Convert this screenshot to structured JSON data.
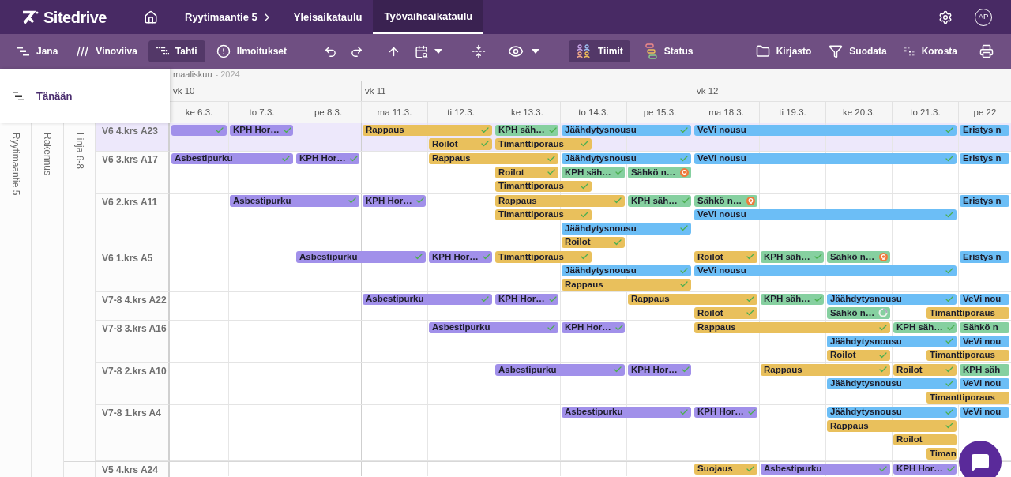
{
  "app": {
    "name": "Sitedrive"
  },
  "nav": {
    "breadcrumb": "Ryytimaantie 5",
    "tabs": [
      {
        "label": "Yleisaikataulu",
        "selected": false
      },
      {
        "label": "Työvaiheaikataulu",
        "selected": true
      }
    ],
    "user_initials": "AP"
  },
  "toolbar": {
    "view_modes": [
      {
        "label": "Jana",
        "selected": false
      },
      {
        "label": "Vinoviiva",
        "selected": false
      },
      {
        "label": "Tahti",
        "selected": true
      }
    ],
    "notifications": "Ilmoitukset",
    "color_modes": [
      {
        "label": "Tiimit",
        "selected": true
      },
      {
        "label": "Status",
        "selected": false
      }
    ],
    "tools": [
      "Kirjasto",
      "Suodata",
      "Korosta"
    ]
  },
  "today_button": "Tänään",
  "timeline": {
    "month": "maaliskuu",
    "year": "- 2024",
    "weeks": [
      {
        "label": "vk 10",
        "days": [
          "ke 6.3.",
          "to 7.3.",
          "pe 8.3."
        ]
      },
      {
        "label": "vk 11",
        "days": [
          "ma 11.3.",
          "ti 12.3.",
          "ke 13.3.",
          "to 14.3.",
          "pe 15.3."
        ]
      },
      {
        "label": "vk 12",
        "days": [
          "ma 18.3.",
          "ti 19.3.",
          "ke 20.3.",
          "to 21.3.",
          "pe 22"
        ]
      }
    ]
  },
  "tree": {
    "site": "Ryytimaantie 5",
    "building": "Rakennus",
    "groups": [
      {
        "line": "Linja 6-8",
        "rows": [
          {
            "name": "V6 4.krs A23",
            "selected": true,
            "bars": [
              {
                "color": "#a190ea",
                "kind": "done"
              },
              {
                "label": "KPH Hor…",
                "color": "#a190ea",
                "kind": "done"
              },
              {
                "label": "Rappaus",
                "color": "#e9c05c",
                "kind": "done"
              },
              {
                "label": "KPH säh…",
                "color": "#86d0a0",
                "kind": "done"
              },
              {
                "label": "Jäähdytysnousu",
                "color": "#6cbef6",
                "kind": "done"
              },
              {
                "label": "VeVi nousu",
                "color": "#6cbef6",
                "kind": "done"
              },
              {
                "label": "Eristys n",
                "color": "#6cbef6",
                "kind": "plain"
              },
              {
                "label": "Roilot",
                "color": "#e9c05c",
                "kind": "done"
              },
              {
                "label": "Timanttiporaus",
                "color": "#e9c05c",
                "kind": "done"
              }
            ]
          },
          {
            "name": "V6 3.krs A17",
            "selected": false,
            "bars": [
              {
                "label": "Asbestipurku",
                "color": "#a190ea",
                "kind": "done"
              },
              {
                "label": "KPH Hor…",
                "color": "#a190ea",
                "kind": "done"
              },
              {
                "label": "Rappaus",
                "color": "#e9c05c",
                "kind": "done"
              },
              {
                "label": "Jäähdytysnousu",
                "color": "#6cbef6",
                "kind": "done"
              },
              {
                "label": "VeVi nousu",
                "color": "#6cbef6",
                "kind": "done"
              },
              {
                "label": "Eristys n",
                "color": "#6cbef6",
                "kind": "plain"
              },
              {
                "label": "Roilot",
                "color": "#e9c05c",
                "kind": "done"
              },
              {
                "label": "KPH säh…",
                "color": "#86d0a0",
                "kind": "done"
              },
              {
                "label": "Sähkö n…",
                "color": "#86d0a0",
                "kind": "alert"
              },
              {
                "label": "Timanttiporaus",
                "color": "#e9c05c",
                "kind": "done"
              }
            ]
          },
          {
            "name": "V6 2.krs A11",
            "selected": false,
            "bars": [
              {
                "label": "Asbestipurku",
                "color": "#a190ea",
                "kind": "done"
              },
              {
                "label": "KPH Hor…",
                "color": "#a190ea",
                "kind": "done"
              },
              {
                "label": "Rappaus",
                "color": "#e9c05c",
                "kind": "done"
              },
              {
                "label": "KPH säh…",
                "color": "#86d0a0",
                "kind": "done"
              },
              {
                "label": "Sähkö n…",
                "color": "#86d0a0",
                "kind": "alert"
              },
              {
                "label": "Eristys n",
                "color": "#6cbef6",
                "kind": "plain"
              },
              {
                "label": "Timanttiporaus",
                "color": "#e9c05c",
                "kind": "done"
              },
              {
                "label": "VeVi nousu",
                "color": "#6cbef6",
                "kind": "done"
              },
              {
                "label": "Jäähdytysnousu",
                "color": "#6cbef6",
                "kind": "done"
              },
              {
                "label": "Roilot",
                "color": "#e9c05c",
                "kind": "done"
              }
            ]
          },
          {
            "name": "V6 1.krs A5",
            "selected": false,
            "bars": [
              {
                "label": "Asbestipurku",
                "color": "#a190ea",
                "kind": "done"
              },
              {
                "label": "KPH Hor…",
                "color": "#a190ea",
                "kind": "done"
              },
              {
                "label": "Timanttiporaus",
                "color": "#e9c05c",
                "kind": "done"
              },
              {
                "label": "Roilot",
                "color": "#e9c05c",
                "kind": "done"
              },
              {
                "label": "KPH säh…",
                "color": "#86d0a0",
                "kind": "done"
              },
              {
                "label": "Sähkö n…",
                "color": "#86d0a0",
                "kind": "alert"
              },
              {
                "label": "Eristys n",
                "color": "#6cbef6",
                "kind": "plain"
              },
              {
                "label": "Jäähdytysnousu",
                "color": "#6cbef6",
                "kind": "done"
              },
              {
                "label": "VeVi nousu",
                "color": "#6cbef6",
                "kind": "done"
              },
              {
                "label": "Rappaus",
                "color": "#e9c05c",
                "kind": "done"
              }
            ]
          },
          {
            "name": "V7-8 4.krs A22",
            "selected": false,
            "bars": [
              {
                "label": "Asbestipurku",
                "color": "#a190ea",
                "kind": "done"
              },
              {
                "label": "KPH Hor…",
                "color": "#a190ea",
                "kind": "done"
              },
              {
                "label": "Rappaus",
                "color": "#e9c05c",
                "kind": "done"
              },
              {
                "label": "KPH säh…",
                "color": "#86d0a0",
                "kind": "done"
              },
              {
                "label": "Jäähdytysnousu",
                "color": "#6cbef6",
                "kind": "done"
              },
              {
                "label": "VeVi nou",
                "color": "#6cbef6",
                "kind": "plain"
              },
              {
                "label": "Roilot",
                "color": "#e9c05c",
                "kind": "done"
              },
              {
                "label": "Sähkö n…",
                "color": "#86d0a0",
                "kind": "progress"
              },
              {
                "label": "Timanttiporaus",
                "color": "#e9c05c",
                "kind": "plain"
              }
            ]
          },
          {
            "name": "V7-8 3.krs A16",
            "selected": false,
            "bars": [
              {
                "label": "Asbestipurku",
                "color": "#a190ea",
                "kind": "done"
              },
              {
                "label": "KPH Hor…",
                "color": "#a190ea",
                "kind": "done"
              },
              {
                "label": "Rappaus",
                "color": "#e9c05c",
                "kind": "done"
              },
              {
                "label": "KPH säh…",
                "color": "#86d0a0",
                "kind": "done"
              },
              {
                "label": "Sähkö n",
                "color": "#86d0a0",
                "kind": "plain"
              },
              {
                "label": "Jäähdytysnousu",
                "color": "#6cbef6",
                "kind": "done"
              },
              {
                "label": "VeVi nou",
                "color": "#6cbef6",
                "kind": "plain"
              },
              {
                "label": "Roilot",
                "color": "#e9c05c",
                "kind": "done"
              },
              {
                "label": "Timanttiporaus",
                "color": "#e9c05c",
                "kind": "plain"
              }
            ]
          },
          {
            "name": "V7-8 2.krs A10",
            "selected": false,
            "bars": [
              {
                "label": "Asbestipurku",
                "color": "#a190ea",
                "kind": "done"
              },
              {
                "label": "KPH Hor…",
                "color": "#a190ea",
                "kind": "done"
              },
              {
                "label": "Rappaus",
                "color": "#e9c05c",
                "kind": "done"
              },
              {
                "label": "Roilot",
                "color": "#e9c05c",
                "kind": "done"
              },
              {
                "label": "KPH säh",
                "color": "#86d0a0",
                "kind": "plain"
              },
              {
                "label": "Jäähdytysnousu",
                "color": "#6cbef6",
                "kind": "done"
              },
              {
                "label": "VeVi nou",
                "color": "#6cbef6",
                "kind": "plain"
              },
              {
                "label": "Timanttiporaus",
                "color": "#e9c05c",
                "kind": "plain"
              }
            ]
          },
          {
            "name": "V7-8 1.krs A4",
            "selected": false,
            "bars": [
              {
                "label": "Asbestipurku",
                "color": "#a190ea",
                "kind": "done"
              },
              {
                "label": "KPH Hor…",
                "color": "#a190ea",
                "kind": "done"
              },
              {
                "label": "Jäähdytysnousu",
                "color": "#6cbef6",
                "kind": "done"
              },
              {
                "label": "VeVi nou",
                "color": "#6cbef6",
                "kind": "plain"
              },
              {
                "label": "Rappaus",
                "color": "#e9c05c",
                "kind": "done"
              },
              {
                "label": "Roilot",
                "color": "#e9c05c",
                "kind": "plain"
              },
              {
                "label": "Timan",
                "color": "#e9c05c",
                "kind": "plain"
              }
            ]
          }
        ]
      },
      {
        "rows": [
          {
            "name": "V5 4.krs A24",
            "selected": false,
            "bars": [
              {
                "label": "Suojaus",
                "color": "#e9c05c",
                "kind": "done"
              },
              {
                "label": "Asbestipurku",
                "color": "#a190ea",
                "kind": "done"
              },
              {
                "label": "KPH Hor…",
                "color": "#a190ea",
                "kind": "done"
              }
            ]
          }
        ]
      }
    ]
  }
}
